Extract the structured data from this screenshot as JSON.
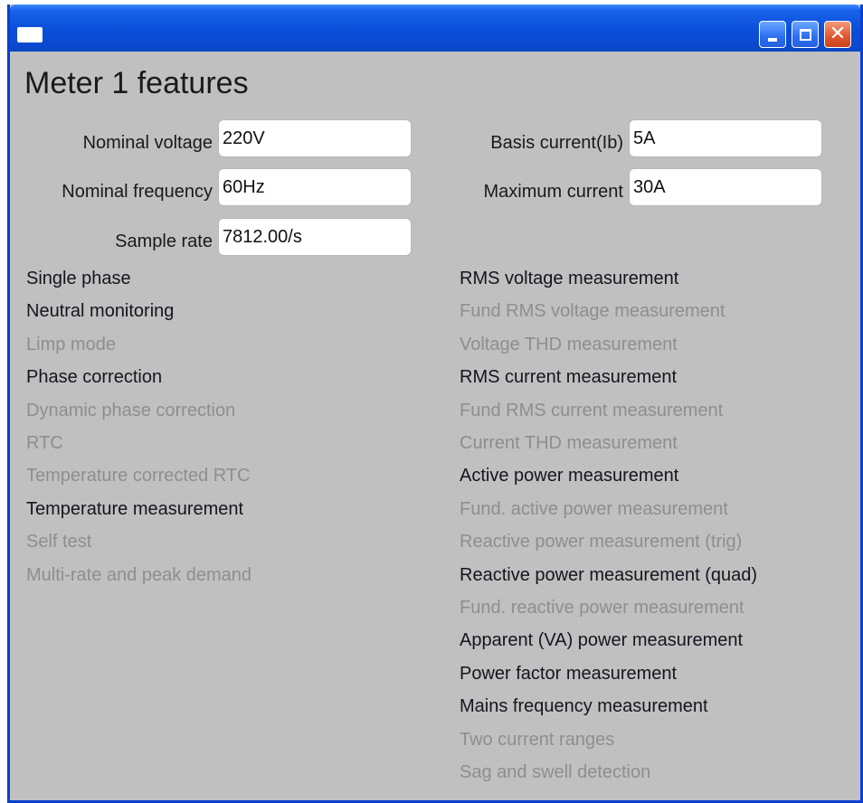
{
  "window": {
    "title": "",
    "controls": {
      "minimize": "minimize-icon",
      "maximize": "maximize-icon",
      "close": "close-icon"
    },
    "colors": {
      "frame": "#0b3fd1",
      "body": "#c0c0c0",
      "close_button": "#e0552c",
      "enabled_text": "#15151f",
      "disabled_text": "#8e8e8e"
    }
  },
  "heading": "Meter 1 features",
  "fields": {
    "nominal_voltage": {
      "label": "Nominal voltage",
      "value": "220V"
    },
    "basis_current": {
      "label": "Basis current(Ib)",
      "value": "5A"
    },
    "nominal_frequency": {
      "label": "Nominal frequency",
      "value": "60Hz"
    },
    "maximum_current": {
      "label": "Maximum current",
      "value": "30A"
    },
    "sample_rate": {
      "label": "Sample rate",
      "value": "7812.00/s"
    }
  },
  "left_features": [
    {
      "label": "Single phase",
      "enabled": true
    },
    {
      "label": "Neutral monitoring",
      "enabled": true
    },
    {
      "label": "Limp mode",
      "enabled": false
    },
    {
      "label": "Phase correction",
      "enabled": true
    },
    {
      "label": "Dynamic phase correction",
      "enabled": false
    },
    {
      "label": "RTC",
      "enabled": false
    },
    {
      "label": "Temperature corrected RTC",
      "enabled": false
    },
    {
      "label": "Temperature measurement",
      "enabled": true
    },
    {
      "label": "Self test",
      "enabled": false
    },
    {
      "label": "Multi-rate and peak demand",
      "enabled": false
    }
  ],
  "right_features": [
    {
      "label": "RMS voltage measurement",
      "enabled": true
    },
    {
      "label": "Fund RMS voltage measurement",
      "enabled": false
    },
    {
      "label": "Voltage THD measurement",
      "enabled": false
    },
    {
      "label": "RMS current measurement",
      "enabled": true
    },
    {
      "label": "Fund RMS current measurement",
      "enabled": false
    },
    {
      "label": "Current THD measurement",
      "enabled": false
    },
    {
      "label": "Active power measurement",
      "enabled": true
    },
    {
      "label": "Fund. active power measurement",
      "enabled": false
    },
    {
      "label": "Reactive power measurement (trig)",
      "enabled": false
    },
    {
      "label": "Reactive power measurement (quad)",
      "enabled": true
    },
    {
      "label": "Fund. reactive power measurement",
      "enabled": false
    },
    {
      "label": "Apparent (VA) power measurement",
      "enabled": true
    },
    {
      "label": "Power factor measurement",
      "enabled": true
    },
    {
      "label": "Mains frequency measurement",
      "enabled": true
    },
    {
      "label": "Two current ranges",
      "enabled": false
    },
    {
      "label": "Sag and swell detection",
      "enabled": false
    }
  ]
}
